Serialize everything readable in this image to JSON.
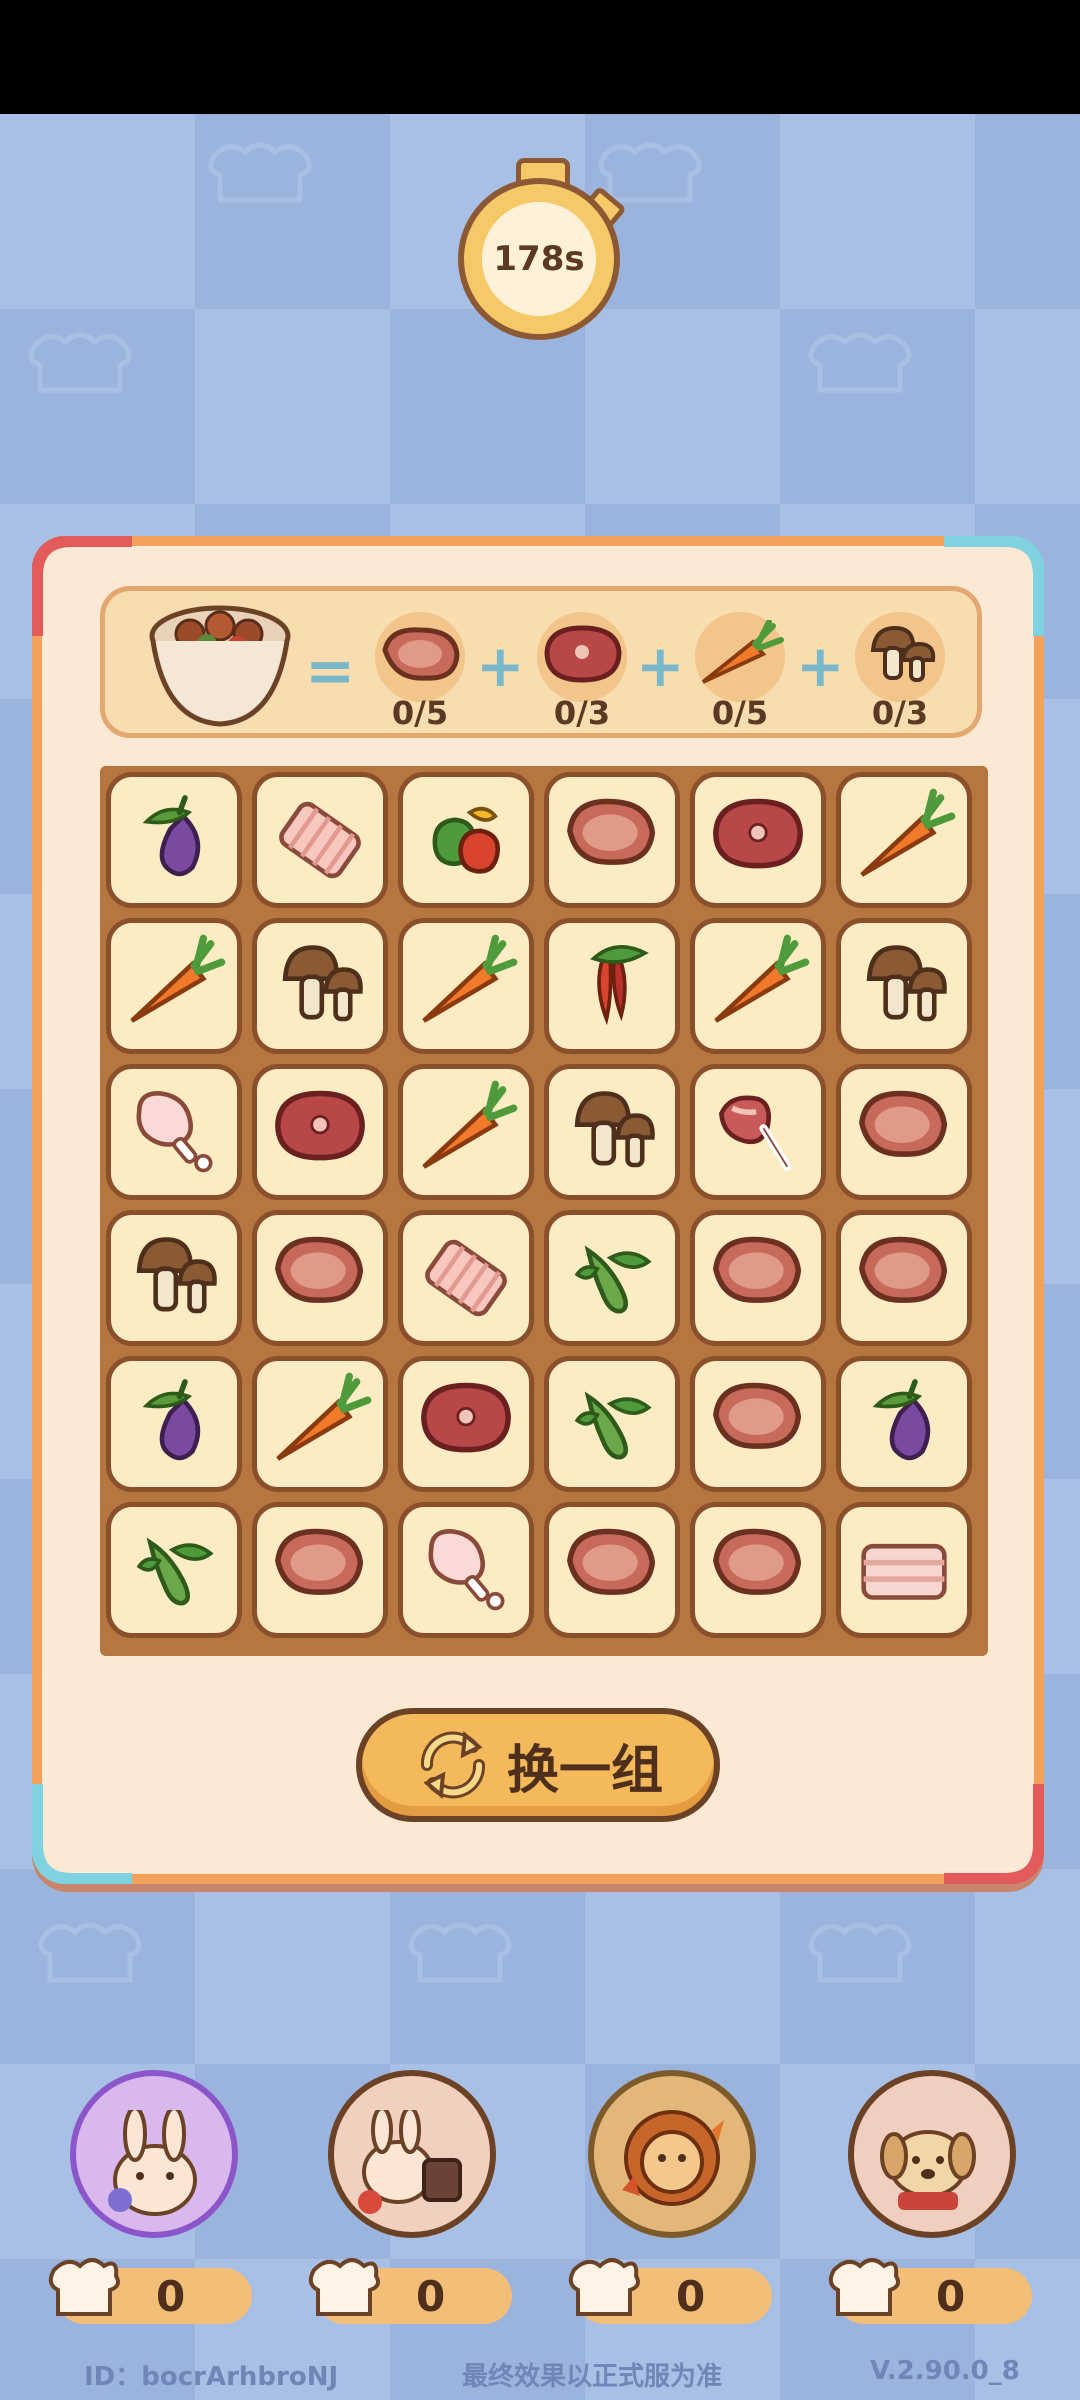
{
  "timer": {
    "label": "178s"
  },
  "recipe": {
    "equals": "=",
    "plus": "+",
    "ingredients": [
      {
        "icon": "steak-icon",
        "count": "0/5"
      },
      {
        "icon": "red-meat-icon",
        "count": "0/3"
      },
      {
        "icon": "carrot-icon",
        "count": "0/5"
      },
      {
        "icon": "mushroom-icon",
        "count": "0/3"
      }
    ]
  },
  "grid": [
    [
      "eggplant",
      "ribs",
      "pepper-mix",
      "steak",
      "red-meat",
      "carrot"
    ],
    [
      "carrot",
      "mushroom",
      "carrot",
      "chili",
      "carrot",
      "mushroom"
    ],
    [
      "drumstick",
      "red-meat",
      "carrot",
      "mushroom",
      "lamb-rack",
      "steak"
    ],
    [
      "mushroom",
      "steak",
      "ribs",
      "cucumber",
      "steak",
      "steak"
    ],
    [
      "eggplant",
      "carrot",
      "red-meat",
      "cucumber",
      "steak",
      "eggplant"
    ],
    [
      "cucumber",
      "steak",
      "drumstick",
      "steak",
      "steak",
      "pork-belly"
    ]
  ],
  "refresh_button": {
    "label": "换一组",
    "icon": "refresh-icon"
  },
  "characters": [
    {
      "name": "purple-wizard-bunny",
      "score": "0",
      "color": "#e7c7f0"
    },
    {
      "name": "chef-bunny",
      "score": "0",
      "color": "#f5d9c5"
    },
    {
      "name": "lion",
      "score": "0",
      "color": "#e9b970"
    },
    {
      "name": "dog",
      "score": "0",
      "color": "#f1d4c6"
    }
  ],
  "footer": {
    "id": "ID：bocrArhbroNJ",
    "notice": "最终效果以正式服为准",
    "version": "V.2.90.0_8"
  },
  "colors": {
    "panel_bg": "#fbe9d5",
    "panel_border": "#f2a25a",
    "board": "#b5763f",
    "tile": "#fcecc4"
  }
}
